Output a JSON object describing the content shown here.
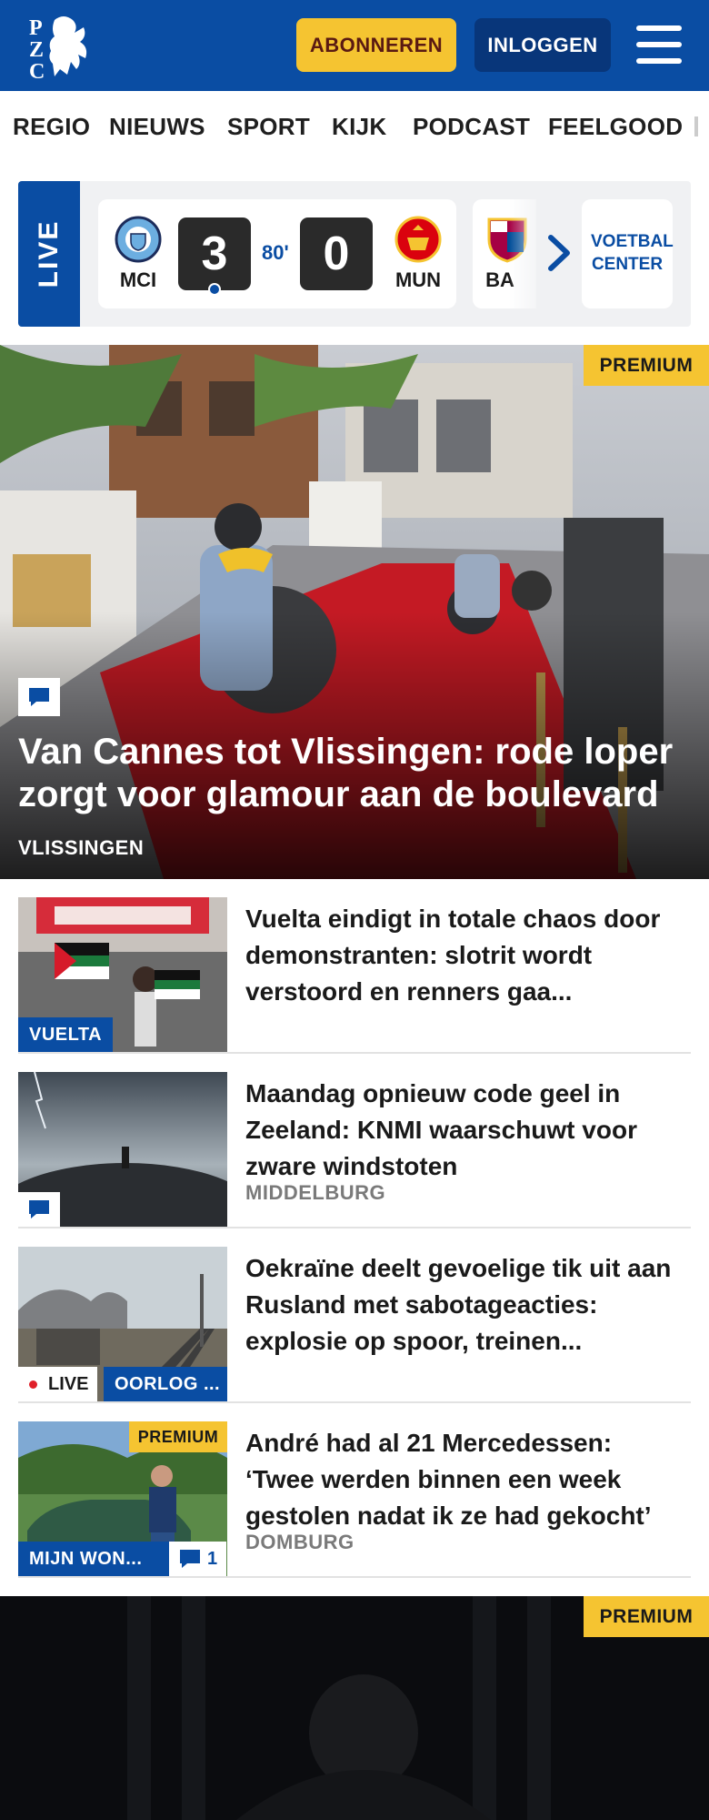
{
  "brand": {
    "logo_letters": [
      "P",
      "Z",
      "C"
    ]
  },
  "header": {
    "subscribe_label": "ABONNEREN",
    "login_label": "INLOGGEN"
  },
  "nav": {
    "items": [
      "REGIO",
      "NIEUWS",
      "SPORT",
      "KIJK",
      "PODCAST",
      "FEELGOOD"
    ]
  },
  "live": {
    "label": "LIVE",
    "match": {
      "home": "MCI",
      "away": "MUN",
      "home_score": "3",
      "away_score": "0",
      "minute": "80'"
    },
    "next_match_code": "BA",
    "center_label": "VOETBAL CENTER"
  },
  "hero": {
    "badge": "PREMIUM",
    "title": "Van Cannes tot Vlissingen: rode loper zorgt voor glamour aan de boulevard",
    "location": "VLISSINGEN"
  },
  "articles": [
    {
      "title": "Vuelta eindigt in totale chaos door demonstranten: slotrit wordt verstoord en renners gaa...",
      "tag": "VUELTA"
    },
    {
      "title": "Maandag opnieuw code geel in Zeeland: KNMI waarschuwt voor zware windstoten",
      "location": "MIDDELBURG"
    },
    {
      "title": "Oekraïne deelt gevoelige tik uit aan Rusland met sabotageacties: explosie op spoor, treinen...",
      "live_label": "LIVE",
      "tag": "OORLOG ..."
    },
    {
      "title": "André had al 21 Mercedessen: ‘Twee werden binnen een week gestolen nadat ik ze had gekocht’",
      "location": "DOMBURG",
      "badge": "PREMIUM",
      "tag": "MIJN WON...",
      "comments": "1"
    }
  ],
  "promo": {
    "badge": "PREMIUM"
  },
  "colors": {
    "brand_blue": "#0a4da3",
    "premium_yellow": "#f5c431",
    "dark_navy": "#08367a"
  }
}
